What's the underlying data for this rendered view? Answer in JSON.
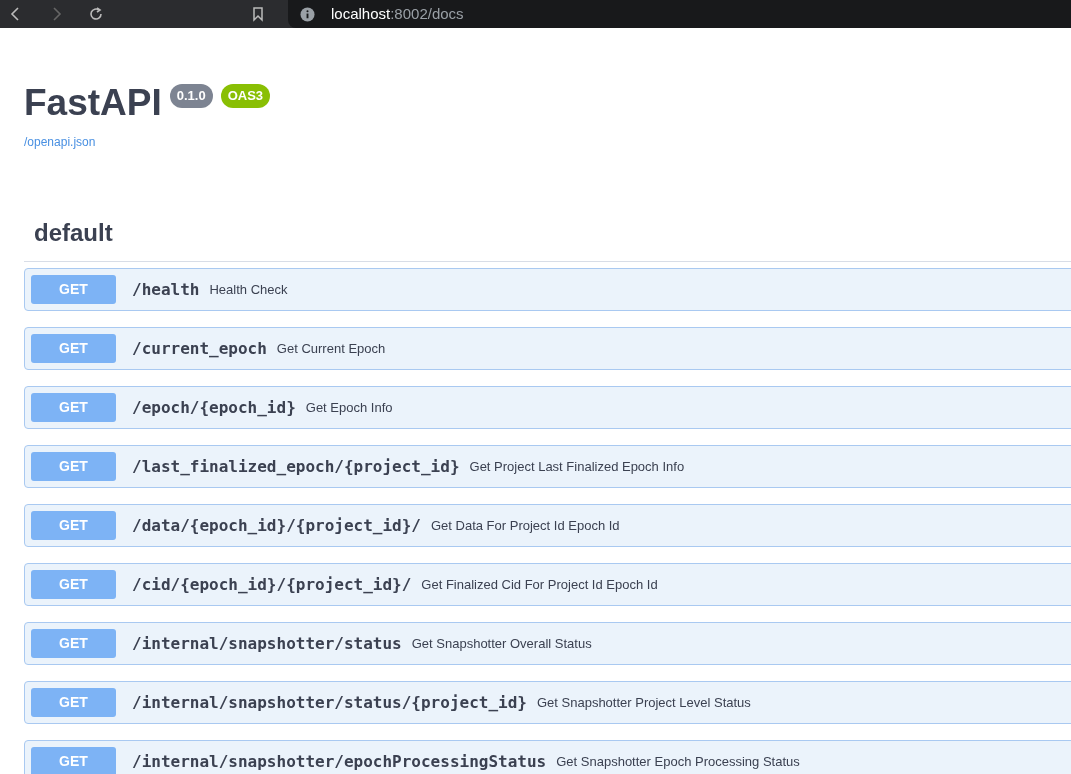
{
  "browser": {
    "url_host": "localhost",
    "url_rest": ":8002/docs"
  },
  "header": {
    "title": "FastAPI",
    "version": "0.1.0",
    "spec": "OAS3",
    "spec_link": "/openapi.json"
  },
  "section": {
    "title": "default",
    "endpoints": [
      {
        "method": "GET",
        "path": "/health",
        "summary": "Health Check"
      },
      {
        "method": "GET",
        "path": "/current_epoch",
        "summary": "Get Current Epoch"
      },
      {
        "method": "GET",
        "path": "/epoch/{epoch_id}",
        "summary": "Get Epoch Info"
      },
      {
        "method": "GET",
        "path": "/last_finalized_epoch/{project_id}",
        "summary": "Get Project Last Finalized Epoch Info"
      },
      {
        "method": "GET",
        "path": "/data/{epoch_id}/{project_id}/",
        "summary": "Get Data For Project Id Epoch Id"
      },
      {
        "method": "GET",
        "path": "/cid/{epoch_id}/{project_id}/",
        "summary": "Get Finalized Cid For Project Id Epoch Id"
      },
      {
        "method": "GET",
        "path": "/internal/snapshotter/status",
        "summary": "Get Snapshotter Overall Status"
      },
      {
        "method": "GET",
        "path": "/internal/snapshotter/status/{project_id}",
        "summary": "Get Snapshotter Project Level Status"
      },
      {
        "method": "GET",
        "path": "/internal/snapshotter/epochProcessingStatus",
        "summary": "Get Snapshotter Epoch Processing Status"
      }
    ]
  }
}
